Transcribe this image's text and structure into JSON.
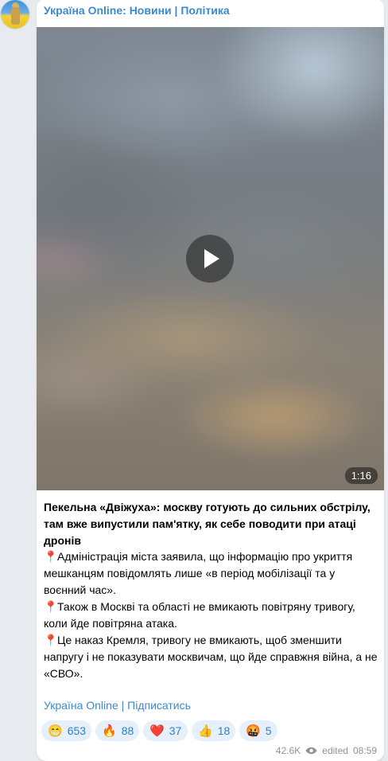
{
  "channel": {
    "name": "Україна Online: Новини | Політика"
  },
  "video": {
    "duration": "1:16"
  },
  "post": {
    "title": "Пекельна «Двіжуха»: москву готують до сильних обстрілу, там вже випустили пам'ятку, як себе поводити при атаці дронів",
    "bullets": [
      "Адміністрація міста заявила, що інформацію про укриття мешканцям повідомлять лише «в період мобілізації та у воєнний час».",
      "Також в Москві та області не вмикають повітряну тривогу, коли йде повітряна атака.",
      "Це наказ Кремля, тривогу не вмикають, щоб зменшити напругу і не показувати москвичам, що йде справжня війна, а не «СВО»."
    ],
    "bullet_icon": "📍",
    "footer_link": "Україна Online | Підписатись"
  },
  "reactions": [
    {
      "emoji": "😁",
      "count": "653"
    },
    {
      "emoji": "🔥",
      "count": "88"
    },
    {
      "emoji": "❤️",
      "count": "37"
    },
    {
      "emoji": "👍",
      "count": "18"
    },
    {
      "emoji": "🤬",
      "count": "5"
    }
  ],
  "meta": {
    "views": "42.6K",
    "edited": "edited",
    "time": "08:59"
  },
  "colors": {
    "accent": "#3a8ad0",
    "background": "#e7ebf0",
    "reaction_bg": "#e6f0fa"
  }
}
